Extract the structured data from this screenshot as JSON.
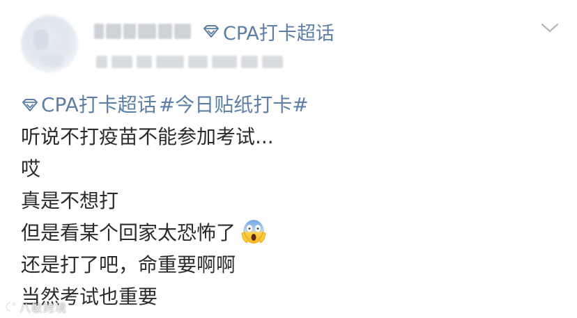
{
  "post": {
    "header": {
      "topic_label": "CPA打卡超话",
      "chevron_icon": "chevron-down-icon",
      "gem_icon": "diamond-icon"
    },
    "body": {
      "topic_tag": "CPA打卡超话",
      "hashtag": "#今日贴纸打卡#",
      "lines": [
        "听说不打疫苗不能参加考试...",
        "哎",
        "真是不想打",
        "但是看某个回家太恐怖了",
        "还是打了吧，命重要啊啊",
        "当然考试也重要"
      ],
      "emoji_name": "face-screaming-in-fear-emoji"
    },
    "watermark": {
      "text": "八敏跨境"
    },
    "colors": {
      "link": "#5b7fa6",
      "text": "#2b2b2b",
      "background": "#ffffff"
    }
  }
}
